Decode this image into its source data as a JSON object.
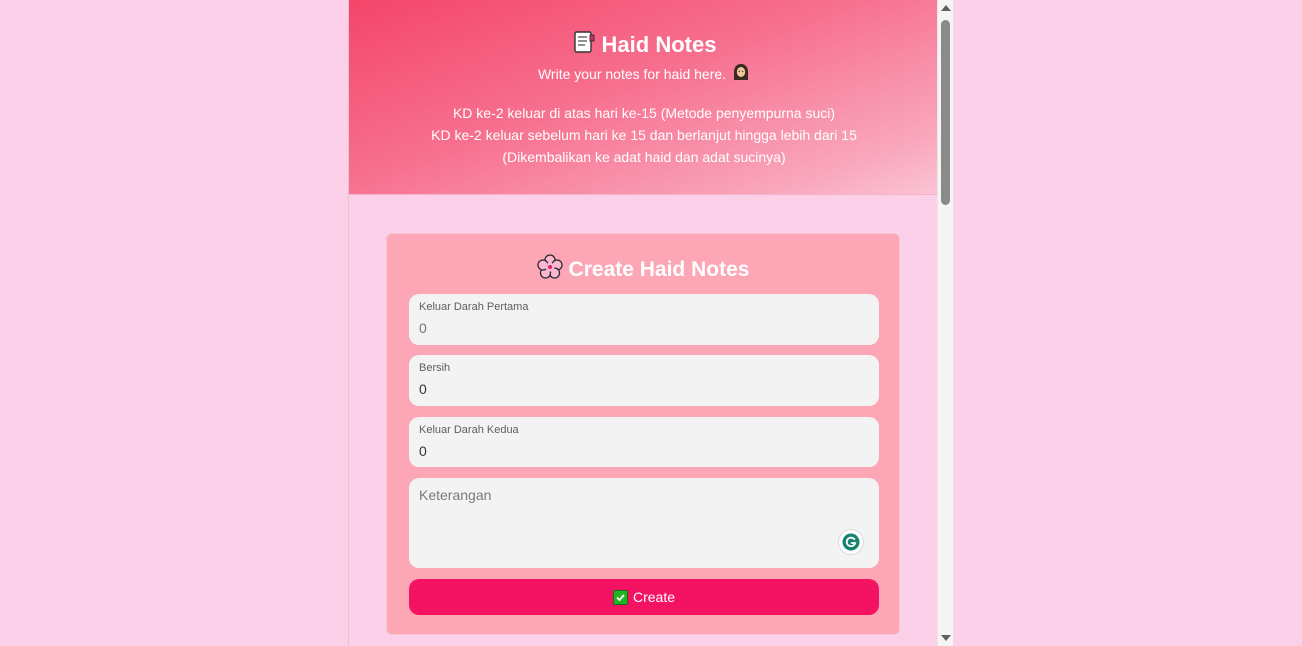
{
  "header": {
    "title": "Haid Notes",
    "title_icon": "notepad-icon",
    "subtitle": "Write your notes for haid here.",
    "subtitle_icon": "woman-hijab-icon",
    "notes": [
      "KD ke-2 keluar di atas hari ke-15 (Metode penyempurna suci)",
      "KD ke-2 keluar sebelum hari ke 15 dan berlanjut hingga lebih dari 15",
      "(Dikembalikan ke adat haid dan adat sucinya)"
    ]
  },
  "form": {
    "title": "Create Haid Notes",
    "title_icon": "cherry-blossom-icon",
    "fields": [
      {
        "label": "Keluar Darah Pertama",
        "placeholder": "0",
        "value": ""
      },
      {
        "label": "Bersih",
        "placeholder": "",
        "value": "0"
      },
      {
        "label": "Keluar Darah Kedua",
        "placeholder": "",
        "value": "0"
      }
    ],
    "notes_placeholder": "Keterangan",
    "create_label": "Create",
    "create_icon": "check-mark-icon"
  },
  "colors": {
    "page_bg": "#fbd0e8",
    "header_gradient_start": "#f4456a",
    "card_bg": "#fda7b6",
    "button_bg": "#f31362",
    "grammarly": "#15846e"
  }
}
